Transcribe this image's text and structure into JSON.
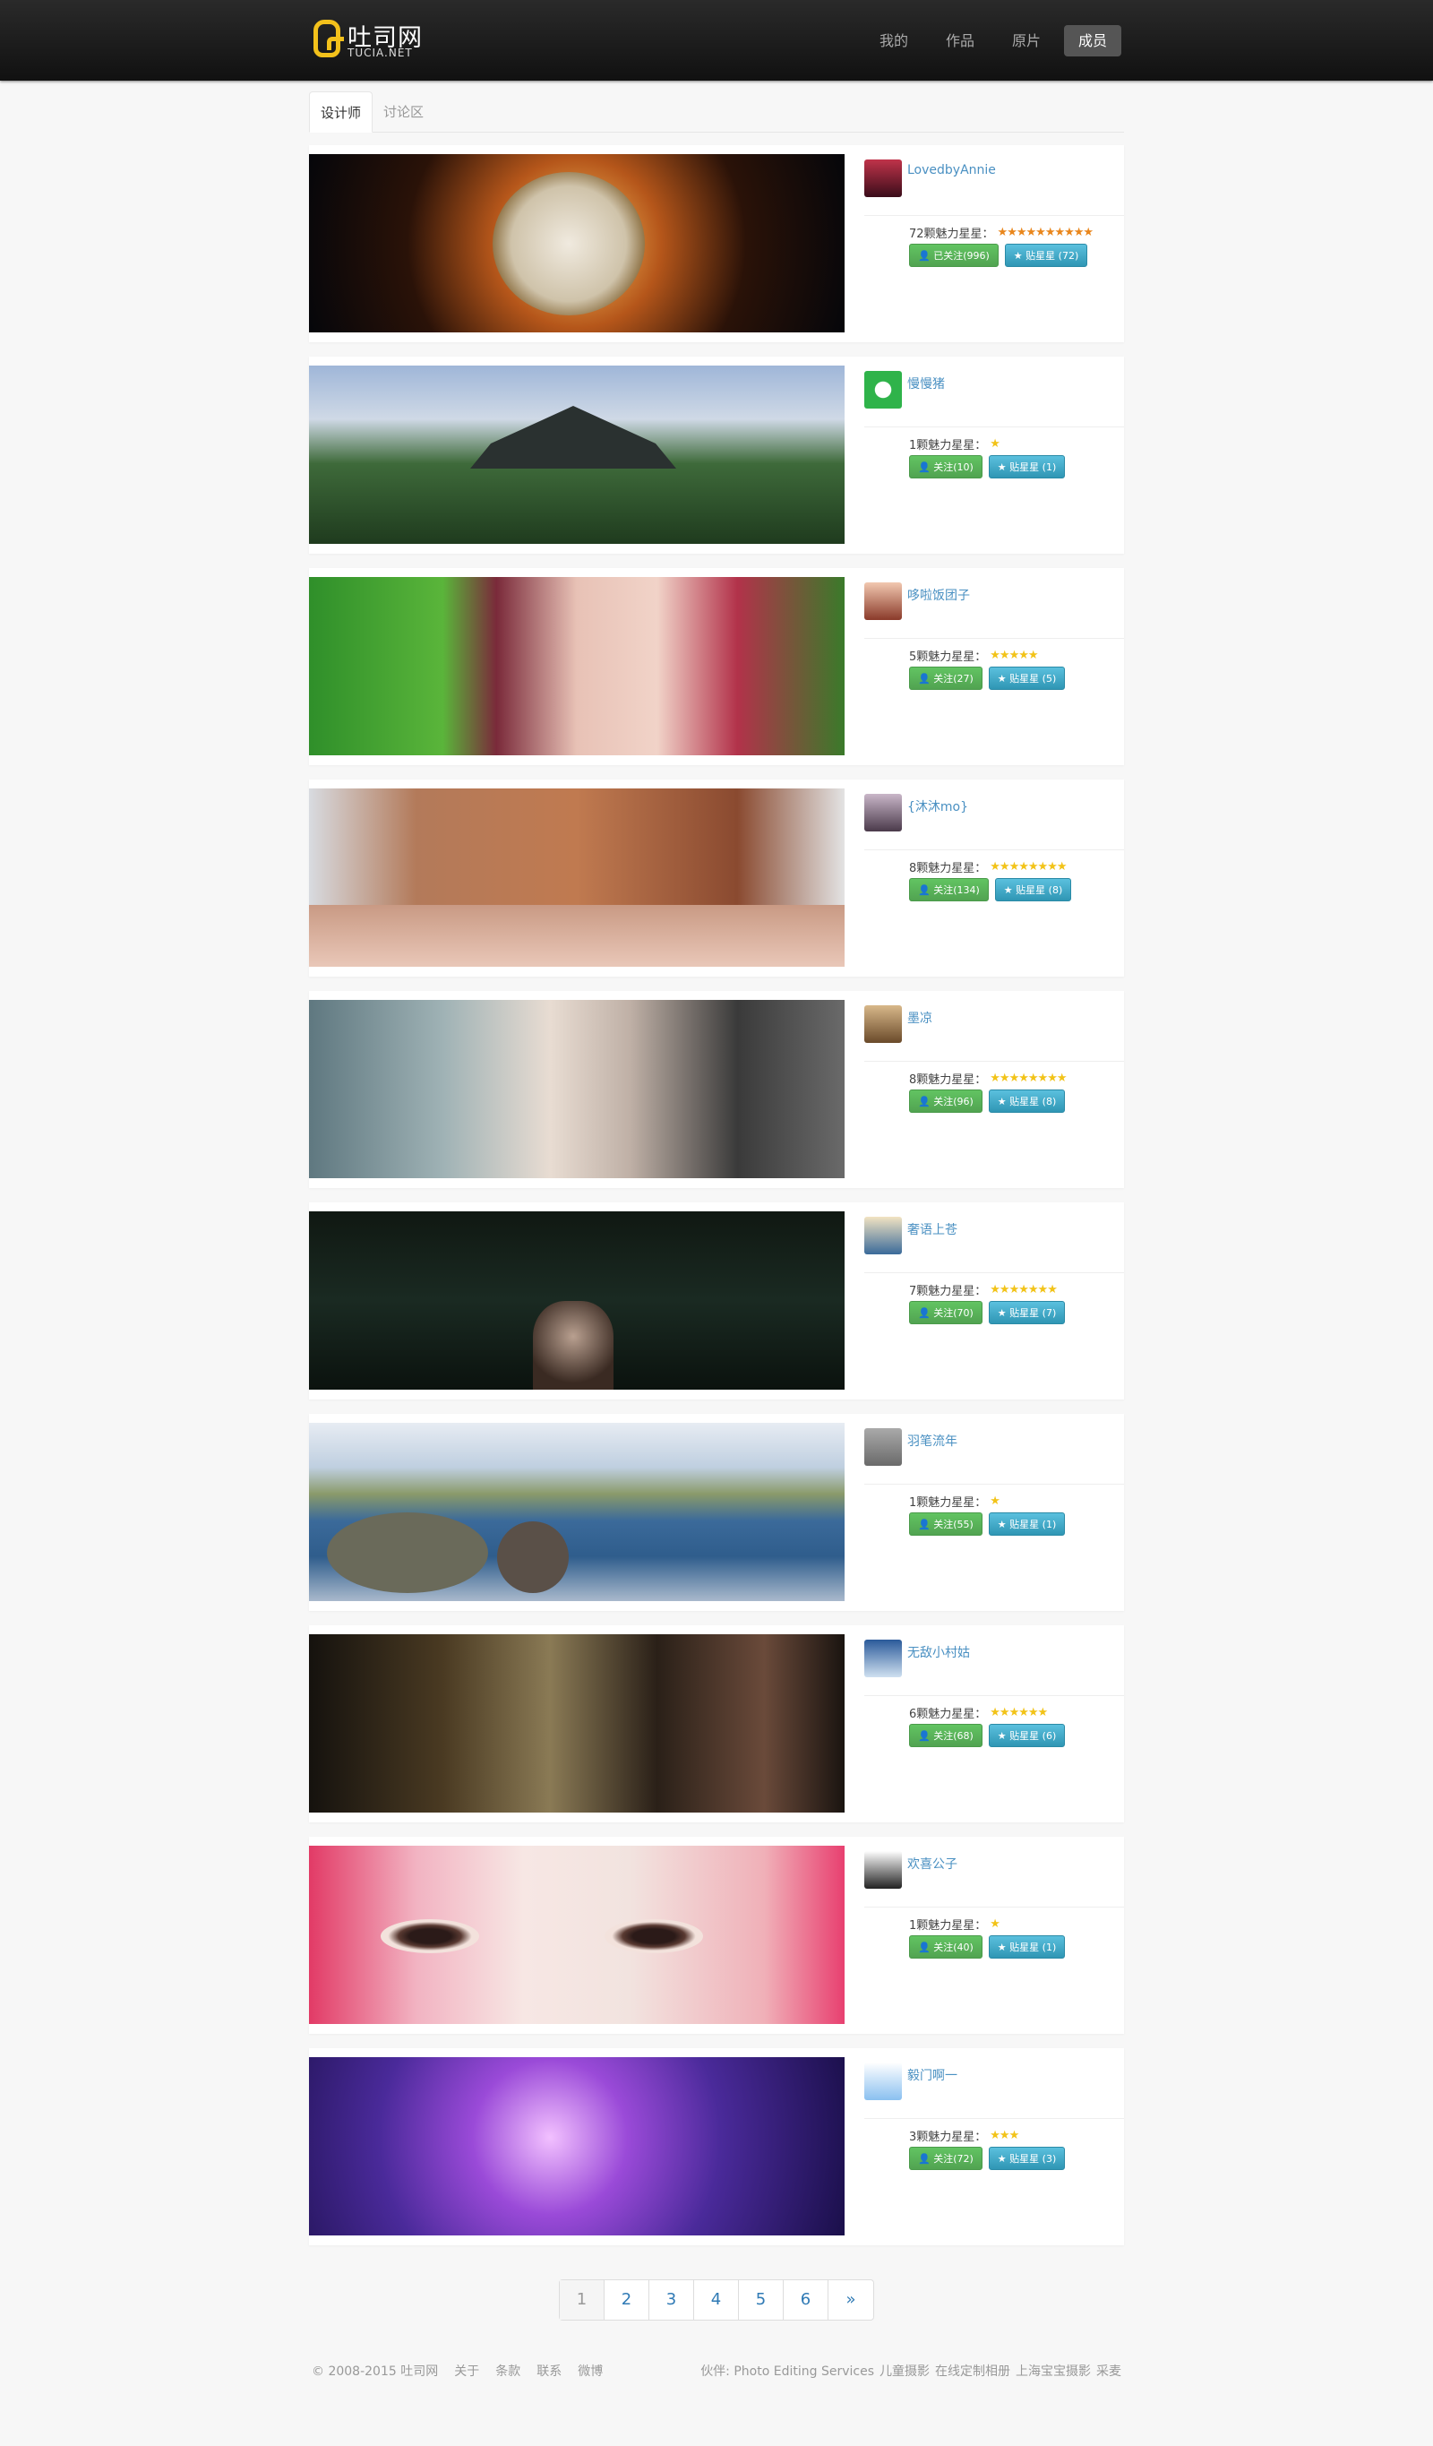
{
  "header": {
    "logo_cn": "吐司网",
    "logo_en": "TUCIA.NET",
    "nav": [
      {
        "label": "我的",
        "active": false
      },
      {
        "label": "作品",
        "active": false
      },
      {
        "label": "原片",
        "active": false
      },
      {
        "label": "成员",
        "active": true
      }
    ]
  },
  "subtabs": [
    {
      "label": "设计师",
      "active": true
    },
    {
      "label": "讨论区",
      "active": false
    }
  ],
  "members": [
    {
      "name": "LovedbyAnnie",
      "charm": "72颗魅力星星：",
      "stars": 10,
      "star_color": "orange",
      "follow": "已关注(996)",
      "star_btn": "贴星星 (72)",
      "banner": "night-city-moon"
    },
    {
      "name": "慢慢猪",
      "charm": "1颗魅力星星：",
      "stars": 1,
      "star_color": "yellow",
      "follow": "关注(10)",
      "star_btn": "贴星星 (1)",
      "banner": "chinese-pavilion-garden"
    },
    {
      "name": "哆啦饭团子",
      "charm": "5颗魅力星星：",
      "stars": 5,
      "star_color": "yellow",
      "follow": "关注(27)",
      "star_btn": "贴星星 (5)",
      "banner": "red-hair-girl-portrait"
    },
    {
      "name": "{沐沐mo}",
      "charm": "8颗魅力星星：",
      "stars": 8,
      "star_color": "yellow",
      "follow": "关注(134)",
      "star_btn": "贴星星 (8)",
      "banner": "brown-bangs-closeup"
    },
    {
      "name": "墨凉",
      "charm": "8颗魅力星星：",
      "stars": 8,
      "star_color": "yellow",
      "follow": "关注(96)",
      "star_btn": "贴星星 (8)",
      "banner": "fantasy-lace-woman"
    },
    {
      "name": "奢语上苍",
      "charm": "7颗魅力星星：",
      "stars": 7,
      "star_color": "yellow",
      "follow": "关注(70)",
      "star_btn": "贴星星 (7)",
      "banner": "dark-forest-girl"
    },
    {
      "name": "羽笔流年",
      "charm": "1颗魅力星星：",
      "stars": 1,
      "star_color": "yellow",
      "follow": "关注(55)",
      "star_btn": "贴星星 (1)",
      "banner": "lake-rock-woman"
    },
    {
      "name": "无敌小村姑",
      "charm": "6颗魅力星星：",
      "stars": 6,
      "star_color": "yellow",
      "follow": "关注(68)",
      "star_btn": "贴星星 (6)",
      "banner": "ornate-costume"
    },
    {
      "name": "欢喜公子",
      "charm": "1颗魅力星星：",
      "stars": 1,
      "star_color": "yellow",
      "follow": "关注(40)",
      "star_btn": "贴星星 (1)",
      "banner": "painted-eyes-pink"
    },
    {
      "name": "毅门啊一",
      "charm": "3颗魅力星星：",
      "stars": 3,
      "star_color": "yellow",
      "follow": "关注(72)",
      "star_btn": "贴星星 (3)",
      "banner": "purple-fantasy"
    }
  ],
  "pagination": [
    "1",
    "2",
    "3",
    "4",
    "5",
    "6",
    "»"
  ],
  "footer": {
    "left": [
      "© 2008-2015 吐司网",
      "关于",
      "条款",
      "联系",
      "微博"
    ],
    "right": [
      "伙伴: Photo Editing Services",
      "儿童摄影",
      "在线定制相册",
      "上海宝宝摄影",
      "采麦"
    ]
  },
  "colors": {
    "accent_link": "#4a90c2",
    "btn_green": "#5cb85c",
    "btn_blue": "#3aa6cc",
    "logo_yellow": "#f3c11b"
  }
}
